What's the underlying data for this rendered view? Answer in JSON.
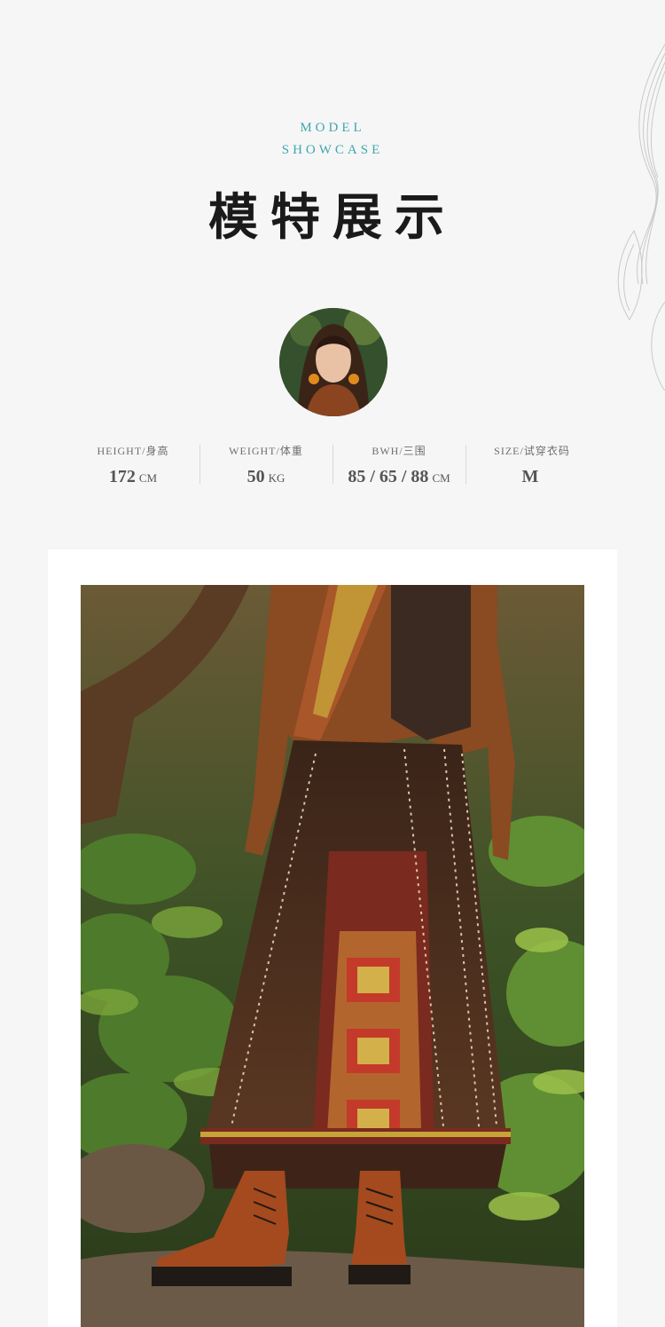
{
  "header": {
    "eyebrow_line1": "MODEL",
    "eyebrow_line2": "SHOWCASE",
    "title": "模特展示"
  },
  "model": {
    "stats": [
      {
        "label": "HEIGHT/身高",
        "value": "172",
        "unit": "CM"
      },
      {
        "label": "WEIGHT/体重",
        "value": "50",
        "unit": "KG"
      },
      {
        "label": "BWH/三围",
        "value": "85 / 65 / 88",
        "unit": "CM"
      },
      {
        "label": "SIZE/试穿衣码",
        "value": "M",
        "unit": ""
      }
    ]
  },
  "colors": {
    "accent": "#3fa7ad",
    "background": "#f6f6f6",
    "card": "#ffffff",
    "skirt": "#4a2c1c"
  }
}
